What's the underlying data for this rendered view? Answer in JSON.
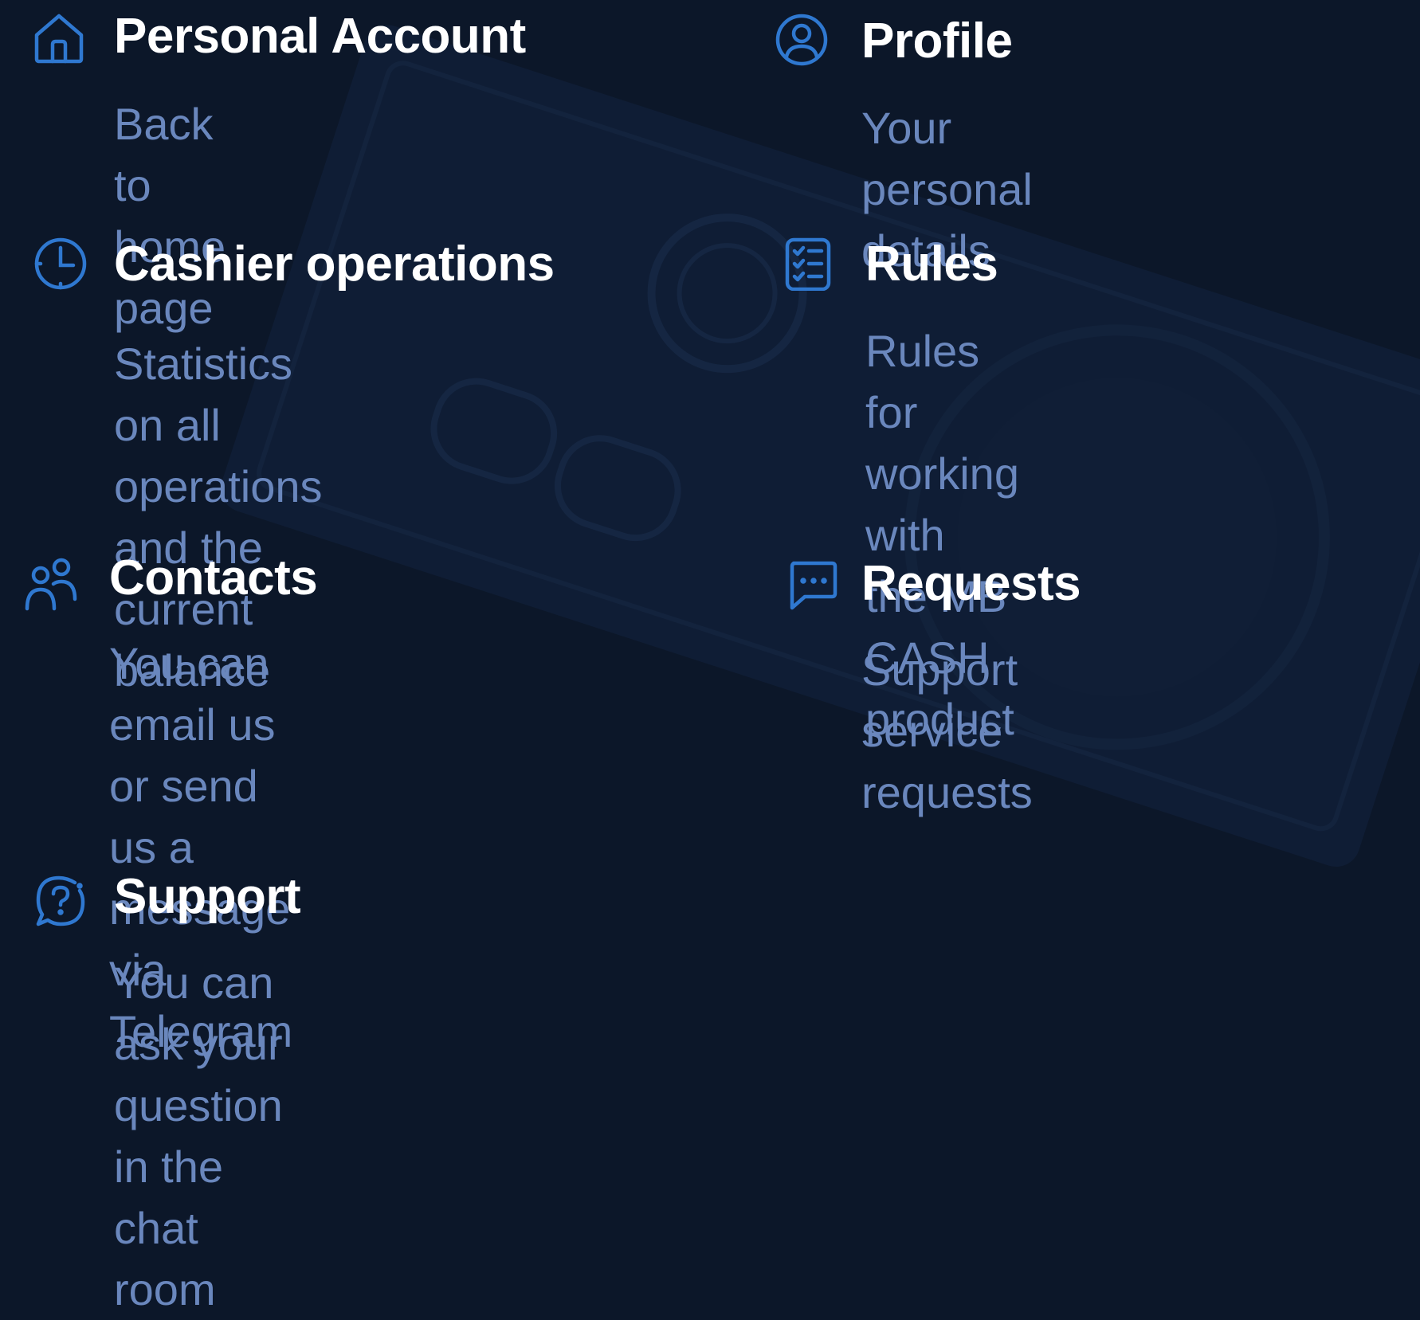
{
  "theme": {
    "background": "#0c1729",
    "icon_color": "#2f78d0",
    "title_color": "#ffffff",
    "description_color": "#6a87bd"
  },
  "menu": {
    "personal_account": {
      "icon": "home-icon",
      "title": "Personal Account",
      "description": "Back to home page"
    },
    "profile": {
      "icon": "user-circle-icon",
      "title": "Profile",
      "description": "Your personal details"
    },
    "cashier_operations": {
      "icon": "clock-icon",
      "title": "Cashier operations",
      "description": "Statistics on all operations\nand the current balance"
    },
    "rules": {
      "icon": "checklist-icon",
      "title": "Rules",
      "description": "Rules for working with\nthe MB CASH product"
    },
    "contacts": {
      "icon": "users-icon",
      "title": "Contacts",
      "description": "You can email us or send\nus a message via Telegram"
    },
    "requests": {
      "icon": "chat-bubble-icon",
      "title": "Requests",
      "description": "Support service requests"
    },
    "support": {
      "icon": "help-chat-icon",
      "title": "Support",
      "description": "You can ask your question\nin the chat room"
    }
  }
}
